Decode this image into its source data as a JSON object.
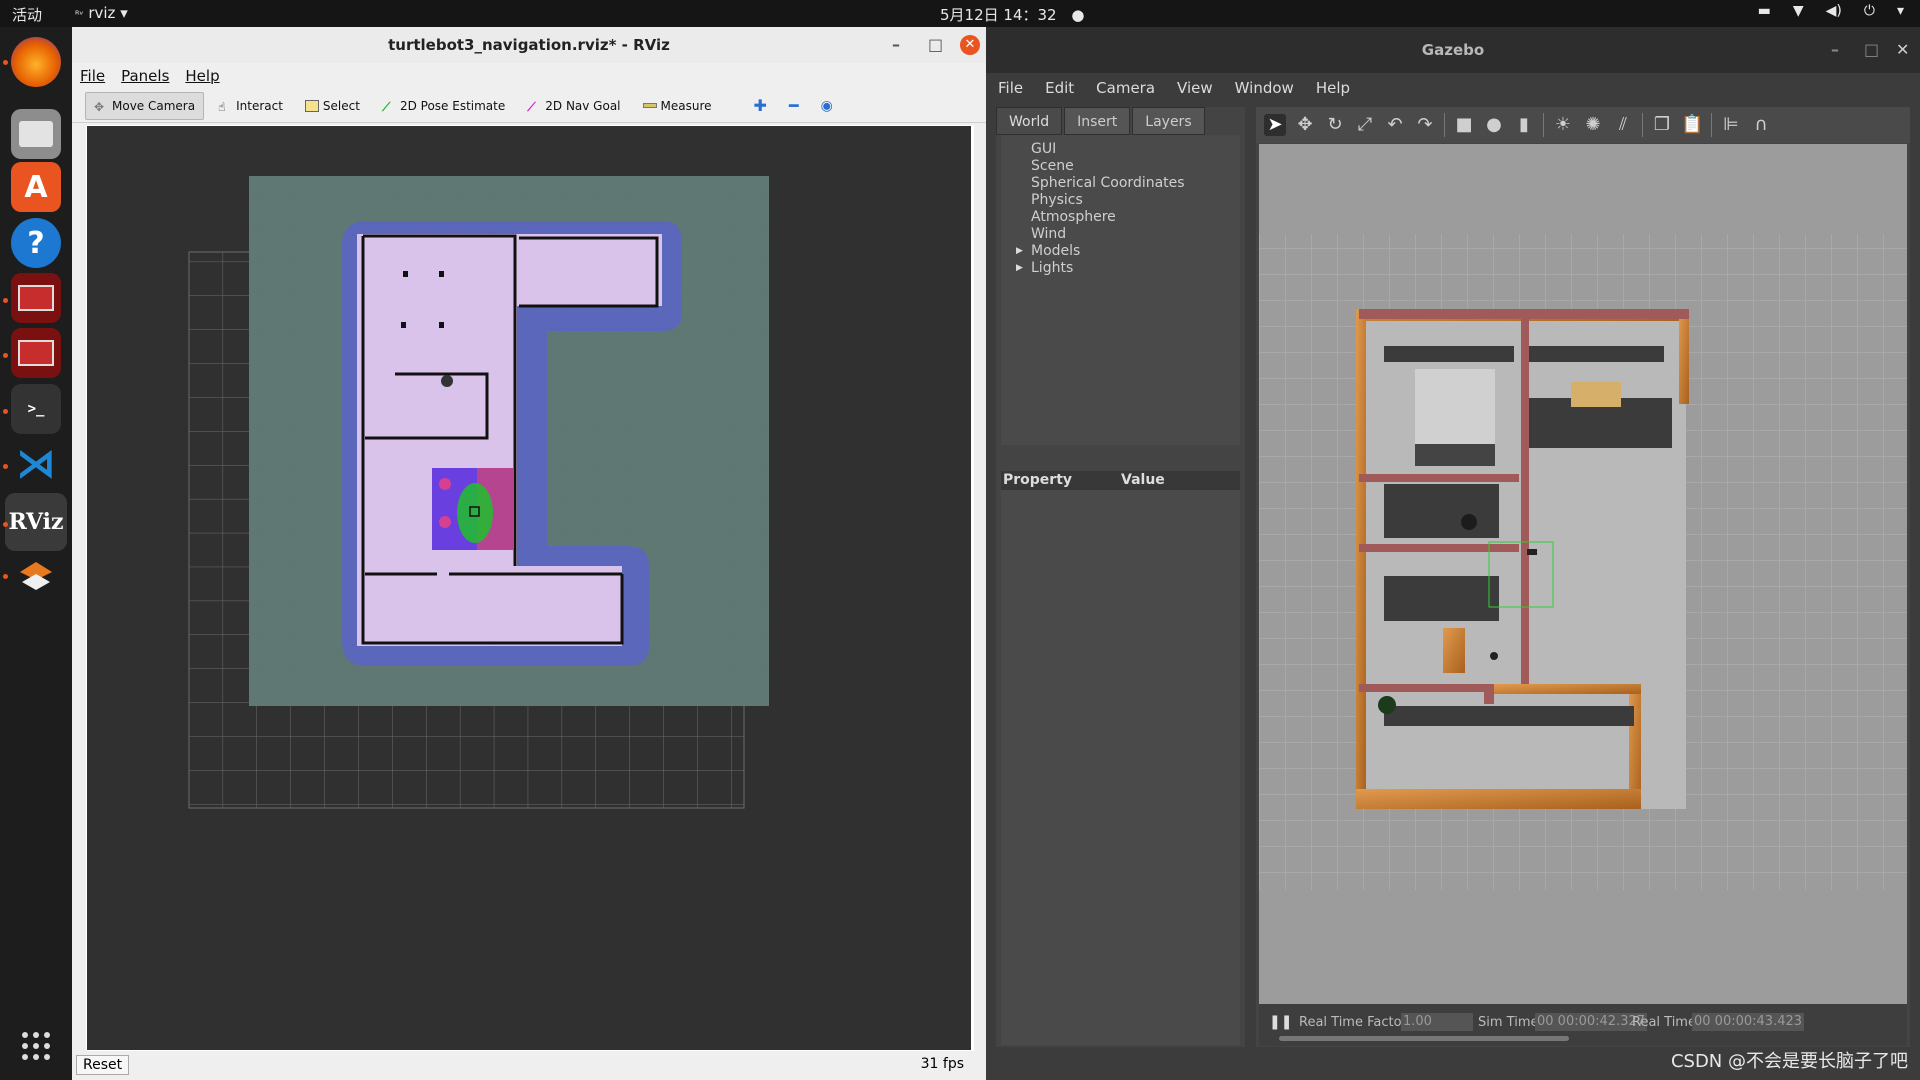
{
  "topbar": {
    "activities": "活动",
    "app_name": "rviz",
    "clock": "5月12日 14：32"
  },
  "dock": {
    "items": [
      {
        "name": "firefox",
        "color": "#e66000"
      },
      {
        "name": "files",
        "color": "#8a8a8a"
      },
      {
        "name": "ubuntu-software",
        "color": "#e95420"
      },
      {
        "name": "help",
        "color": "#1c78d0"
      },
      {
        "name": "terminal-1",
        "color": "#a11d1d"
      },
      {
        "name": "terminal-2",
        "color": "#a11d1d"
      },
      {
        "name": "terminal",
        "color": "#333333"
      },
      {
        "name": "vscode",
        "color": "#1d89d6"
      },
      {
        "name": "rviz",
        "color": "#333333"
      },
      {
        "name": "stack",
        "color": "#e8791e"
      }
    ]
  },
  "rviz": {
    "title": "turtlebot3_navigation.rviz* - RViz",
    "menu": {
      "file": "File",
      "panels": "Panels",
      "help": "Help"
    },
    "tools": {
      "move_camera": "Move Camera",
      "interact": "Interact",
      "select": "Select",
      "pose_estimate": "2D Pose Estimate",
      "nav_goal": "2D Nav Goal",
      "measure": "Measure"
    },
    "reset": "Reset",
    "fps": "31 fps"
  },
  "gazebo": {
    "title": "Gazebo",
    "menu": {
      "file": "File",
      "edit": "Edit",
      "camera": "Camera",
      "view": "View",
      "window": "Window",
      "help": "Help"
    },
    "tabs": {
      "world": "World",
      "insert": "Insert",
      "layers": "Layers"
    },
    "tree": {
      "gui": "GUI",
      "scene": "Scene",
      "spherical": "Spherical Coordinates",
      "physics": "Physics",
      "atmosphere": "Atmosphere",
      "wind": "Wind",
      "models": "Models",
      "lights": "Lights"
    },
    "property_header": "Property",
    "value_header": "Value",
    "status": {
      "rtf_label": "Real Time Factor:",
      "rtf_value": "1.00",
      "sim_label": "Sim Time:",
      "sim_value": "00 00:00:42.327",
      "real_label": "Real Time:",
      "real_value": "00 00:00:43.423"
    }
  },
  "watermark": "CSDN @不会是要长脑子了吧"
}
